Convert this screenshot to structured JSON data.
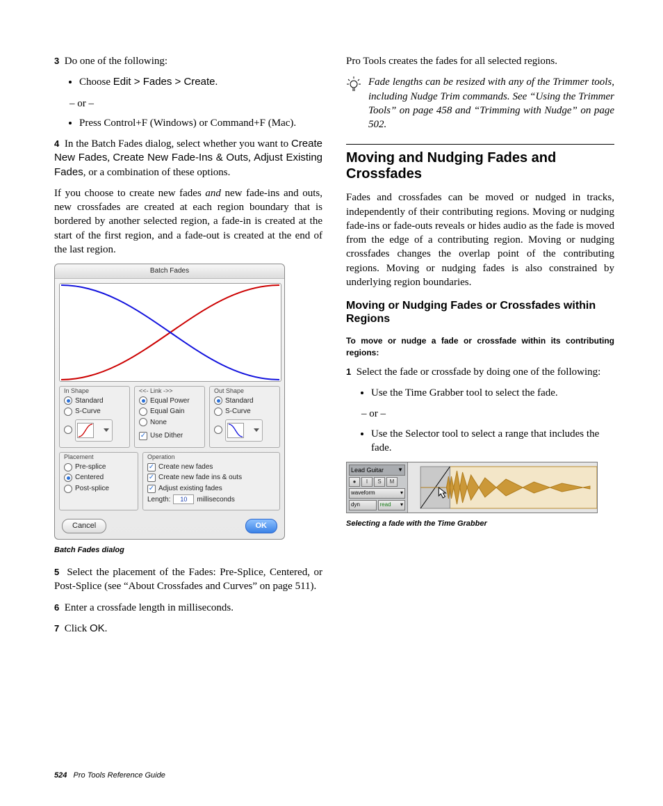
{
  "left": {
    "step3": {
      "num": "3",
      "text": "Do one of the following:"
    },
    "step3_bullet1_a": "Choose ",
    "step3_bullet1_b": "Edit > Fades > Create",
    "step3_bullet1_c": ".",
    "or": "– or –",
    "step3_bullet2": "Press Control+F (Windows) or Command+F (Mac).",
    "step4": {
      "num": "4",
      "a": "In the Batch Fades dialog, select whether you want to ",
      "b": "Create New Fades",
      "c": ", ",
      "d": "Create New Fade-Ins & Outs",
      "e": ", ",
      "f": "Adjust Existing Fades",
      "g": ", or a combination of these options."
    },
    "para_newfades_a": "If you choose to create new fades ",
    "para_newfades_b": "and",
    "para_newfades_c": " new fade-ins and outs, new crossfades are created at each region boundary that is bordered by another selected region, a fade-in is created at the start of the first region, and a fade-out is created at the end of the last region.",
    "dialog": {
      "title": "Batch Fades",
      "in_shape": "In Shape",
      "link": "<<- Link ->>",
      "out_shape": "Out Shape",
      "standard": "Standard",
      "s_curve": "S-Curve",
      "equal_power": "Equal Power",
      "equal_gain": "Equal Gain",
      "none": "None",
      "use_dither": "Use Dither",
      "placement": "Placement",
      "pre_splice": "Pre-splice",
      "centered": "Centered",
      "post_splice": "Post-splice",
      "operation": "Operation",
      "create_new_fades": "Create new fades",
      "create_new_fadeio": "Create new fade ins & outs",
      "adjust_existing": "Adjust existing fades",
      "length_label": "Length:",
      "length_value": "10",
      "ms": "milliseconds",
      "cancel": "Cancel",
      "ok": "OK"
    },
    "fig1_caption": "Batch Fades dialog",
    "step5": {
      "num": "5",
      "text": "Select the placement of the Fades: Pre-Splice, Centered, or Post-Splice (see “About Crossfades and Curves” on page 511)."
    },
    "step6": {
      "num": "6",
      "text": "Enter a crossfade length in milliseconds."
    },
    "step7": {
      "num": "7",
      "a": "Click ",
      "b": "OK",
      "c": "."
    }
  },
  "right": {
    "para1": "Pro Tools creates the fades for all selected regions.",
    "tip": "Fade lengths can be resized with any of the Trimmer tools, including Nudge Trim commands. See “Using the Trimmer Tools” on page 458 and “Trimming with Nudge” on page 502.",
    "h2": "Moving and Nudging Fades and Crossfades",
    "para2": "Fades and crossfades can be moved or nudged in tracks, independently of their contributing regions. Moving or nudging fade-ins or fade-outs reveals or hides audio as the fade is moved from the edge of a contributing region. Moving or nudging crossfades changes the overlap point of the contributing regions. Moving or nudging fades is also constrained by underlying region boundaries.",
    "h3": "Moving or Nudging Fades or Crossfades within Regions",
    "runin": "To move or nudge a fade or crossfade within its contributing regions:",
    "step1": {
      "num": "1",
      "text": "Select the fade or crossfade by doing one of the following:"
    },
    "bullet1": "Use the Time Grabber tool to select the fade.",
    "or": "– or –",
    "bullet2": "Use the Selector tool to select a range that includes the fade.",
    "track": {
      "name": "Lead Guitar",
      "rec": "●",
      "inp": "I",
      "solo": "S",
      "mute": "M",
      "wave": "waveform",
      "dyn": "dyn",
      "read": "read"
    },
    "fig2_caption": "Selecting a fade with the Time Grabber"
  },
  "footer": {
    "page": "524",
    "book": "Pro Tools Reference Guide"
  }
}
